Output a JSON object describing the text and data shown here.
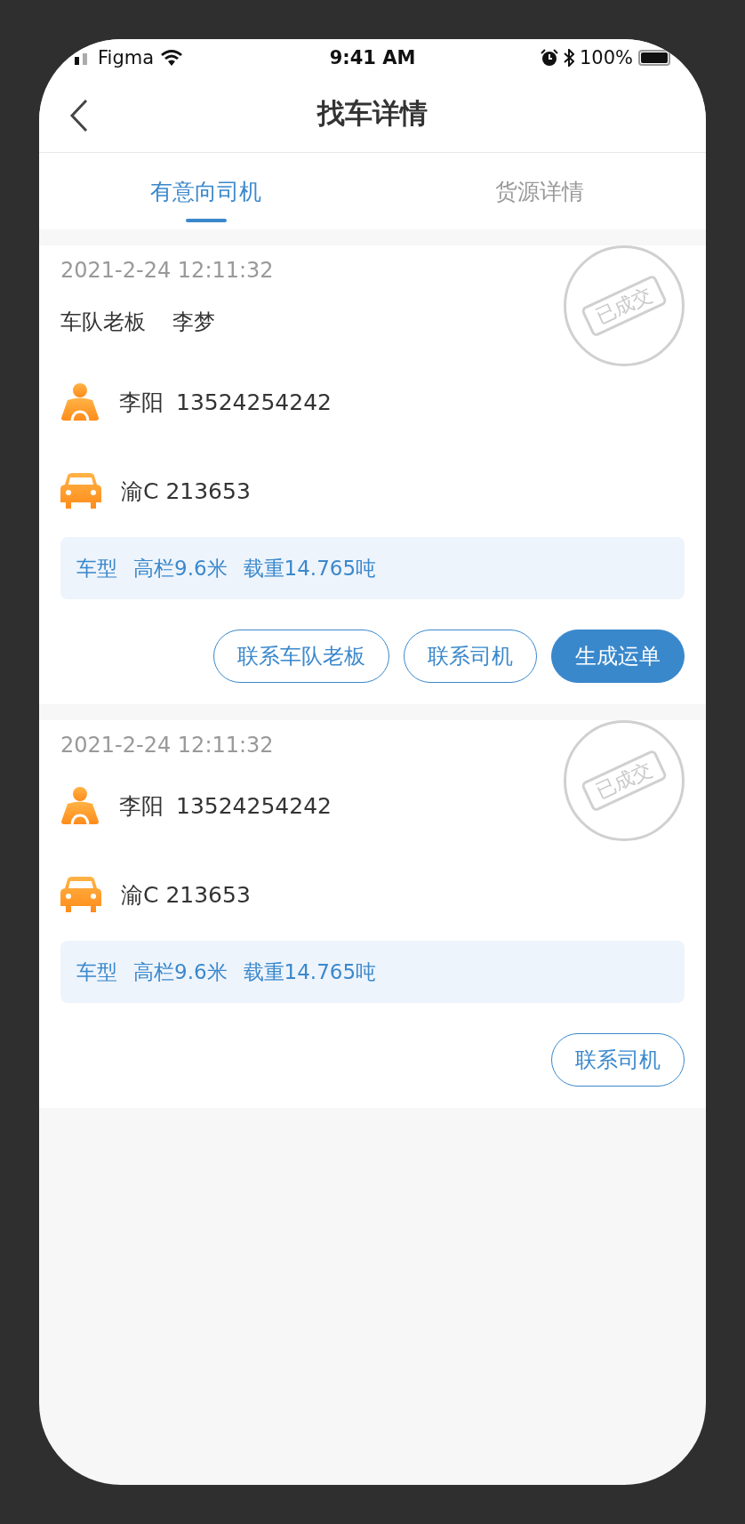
{
  "status_bar": {
    "carrier": "Figma",
    "time": "9:41 AM",
    "battery": "100%"
  },
  "nav": {
    "title": "找车详情"
  },
  "tabs": [
    {
      "label": "有意向司机",
      "selected": true
    },
    {
      "label": "货源详情",
      "selected": false
    }
  ],
  "cards": [
    {
      "time": "2021-2-24 12:11:32",
      "stamp": "已成交",
      "boss": {
        "label": "车队老板",
        "name": "李梦"
      },
      "driver": {
        "name": "李阳",
        "phone": "13524254242"
      },
      "plate": "渝C 213653",
      "specs": [
        "车型",
        "高栏9.6米",
        "载重14.765吨"
      ],
      "buttons": [
        {
          "label": "联系车队老板",
          "kind": "outline"
        },
        {
          "label": "联系司机",
          "kind": "outline"
        },
        {
          "label": "生成运单",
          "kind": "primary"
        }
      ]
    },
    {
      "time": "2021-2-24 12:11:32",
      "stamp": "已成交",
      "driver": {
        "name": "李阳",
        "phone": "13524254242"
      },
      "plate": "渝C 213653",
      "specs": [
        "车型",
        "高栏9.6米",
        "载重14.765吨"
      ],
      "buttons": [
        {
          "label": "联系司机",
          "kind": "outline"
        }
      ]
    }
  ]
}
